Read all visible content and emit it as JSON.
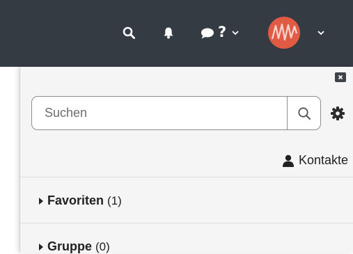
{
  "header": {
    "icons": [
      "search-icon",
      "bell-icon",
      "chat-icon",
      "help-icon",
      "chevron-down-icon",
      "avatar",
      "chevron-down-icon"
    ],
    "help_label": "?",
    "background": "#353b42",
    "avatar_color": "#e05a44"
  },
  "contacts_panel": {
    "close_icon": "close-icon",
    "search": {
      "placeholder": "Suchen",
      "value": ""
    },
    "settings_icon": "gear-icon",
    "contacts_link": "Kontakte",
    "groups": [
      {
        "name": "Favoriten",
        "count": "(1)"
      },
      {
        "name": "Gruppe",
        "count": "(0)"
      }
    ]
  }
}
